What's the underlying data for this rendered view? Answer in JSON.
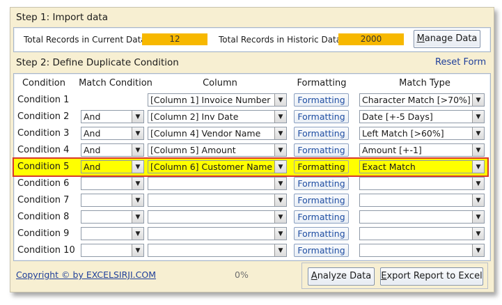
{
  "step1": {
    "title": "Step 1: Import data",
    "current_label": "Total Records in Current Data:",
    "current_value": "12",
    "historic_label": "Total Records in Historic Data:",
    "historic_value": "2000",
    "manage_button": "Manage Data"
  },
  "step2": {
    "title": "Step 2: Define Duplicate Condition",
    "reset_link": "Reset Form"
  },
  "headers": {
    "condition": "Condition",
    "match_condition": "Match Condition",
    "column": "Column",
    "formatting": "Formatting",
    "match_type": "Match Type"
  },
  "rows": [
    {
      "name": "Condition 1",
      "match": "",
      "column": "[Column 1] Invoice Number",
      "formatting": "Formatting",
      "match_type": "Character Match [>70%]"
    },
    {
      "name": "Condition 2",
      "match": "And",
      "column": "[Column 2] Inv Date",
      "formatting": "Formatting",
      "match_type": "Date [+-5 Days]"
    },
    {
      "name": "Condition 3",
      "match": "And",
      "column": "[Column 4] Vendor Name",
      "formatting": "Formatting",
      "match_type": "Left Match [>60%]"
    },
    {
      "name": "Condition 4",
      "match": "And",
      "column": "[Column 5] Amount",
      "formatting": "Formatting",
      "match_type": "Amount [+-1]"
    },
    {
      "name": "Condition 5",
      "match": "And",
      "column": "[Column 6] Customer Name",
      "formatting": "Formatting",
      "match_type": "Exact Match",
      "highlighted": true
    },
    {
      "name": "Condition 6",
      "match": "",
      "column": "",
      "formatting": "Formatting",
      "match_type": ""
    },
    {
      "name": "Condition 7",
      "match": "",
      "column": "",
      "formatting": "Formatting",
      "match_type": ""
    },
    {
      "name": "Condition 8",
      "match": "",
      "column": "",
      "formatting": "Formatting",
      "match_type": ""
    },
    {
      "name": "Condition 9",
      "match": "",
      "column": "",
      "formatting": "Formatting",
      "match_type": ""
    },
    {
      "name": "Condition 10",
      "match": "",
      "column": "",
      "formatting": "Formatting",
      "match_type": ""
    }
  ],
  "footer": {
    "copyright": "Copyright © by EXCELSIRJI.COM",
    "progress": "0%",
    "analyze_button": "Analyze Data",
    "export_button": "Export Report to Excel"
  },
  "icons": {
    "dropdown": "chevron-down-icon"
  },
  "colors": {
    "count_bg": "#f7b800",
    "highlight": "#ffff00",
    "highlight_border": "#d83a2a",
    "link": "#1f3f9a"
  }
}
